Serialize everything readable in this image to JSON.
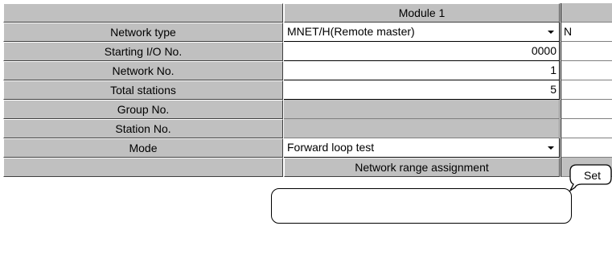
{
  "header": {
    "module_label": "Module 1"
  },
  "rows": {
    "network_type": {
      "label": "Network type",
      "value": "MNET/H(Remote master)",
      "next_value": "N"
    },
    "starting_io": {
      "label": "Starting I/O No.",
      "value": "0000"
    },
    "network_no": {
      "label": "Network No.",
      "value": "1"
    },
    "total_stations": {
      "label": "Total stations",
      "value": "5"
    },
    "group_no": {
      "label": "Group No."
    },
    "station_no": {
      "label": "Station No."
    },
    "mode": {
      "label": "Mode",
      "value": "Forward loop test"
    },
    "range_assign": {
      "label": "Network range assignment"
    }
  },
  "callout": {
    "text": "Set"
  }
}
